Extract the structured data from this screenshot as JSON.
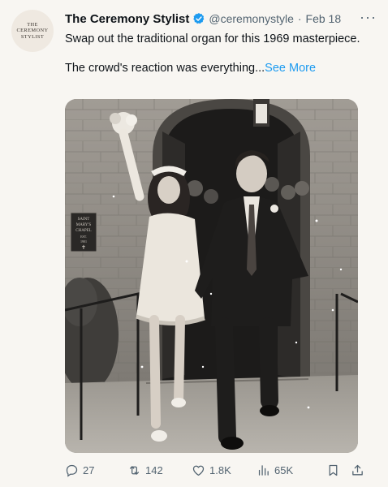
{
  "avatar": {
    "line1": "THE",
    "line2": "CEREMONY",
    "line3": "STYLIST"
  },
  "tweet": {
    "display_name": "The Ceremony Stylist",
    "handle": "@ceremonystyle",
    "separator": "·",
    "date": "Feb 18",
    "more_label": "···",
    "paragraph1": "Swap out the traditional organ for this 1969 masterpiece.",
    "paragraph2": "The crowd's reaction was everything...",
    "see_more": "See More"
  },
  "photo": {
    "plaque_line1": "SAINT",
    "plaque_line2": "MARY'S",
    "plaque_line3": "CHAPEL",
    "plaque_line4": "EST.",
    "plaque_line5": "1901",
    "plaque_cross": "✝"
  },
  "actions": {
    "replies": "27",
    "retweets": "142",
    "likes": "1.8K",
    "views": "65K"
  },
  "icons": {
    "verified": "verified-badge-icon",
    "reply": "reply-icon",
    "retweet": "retweet-icon",
    "like": "heart-icon",
    "views": "views-icon",
    "bookmark": "bookmark-icon",
    "share": "share-icon",
    "more": "more-icon"
  },
  "colors": {
    "background": "#f8f6f2",
    "verified": "#1d9bf0",
    "link": "#1d9bf0",
    "muted": "#536471"
  }
}
